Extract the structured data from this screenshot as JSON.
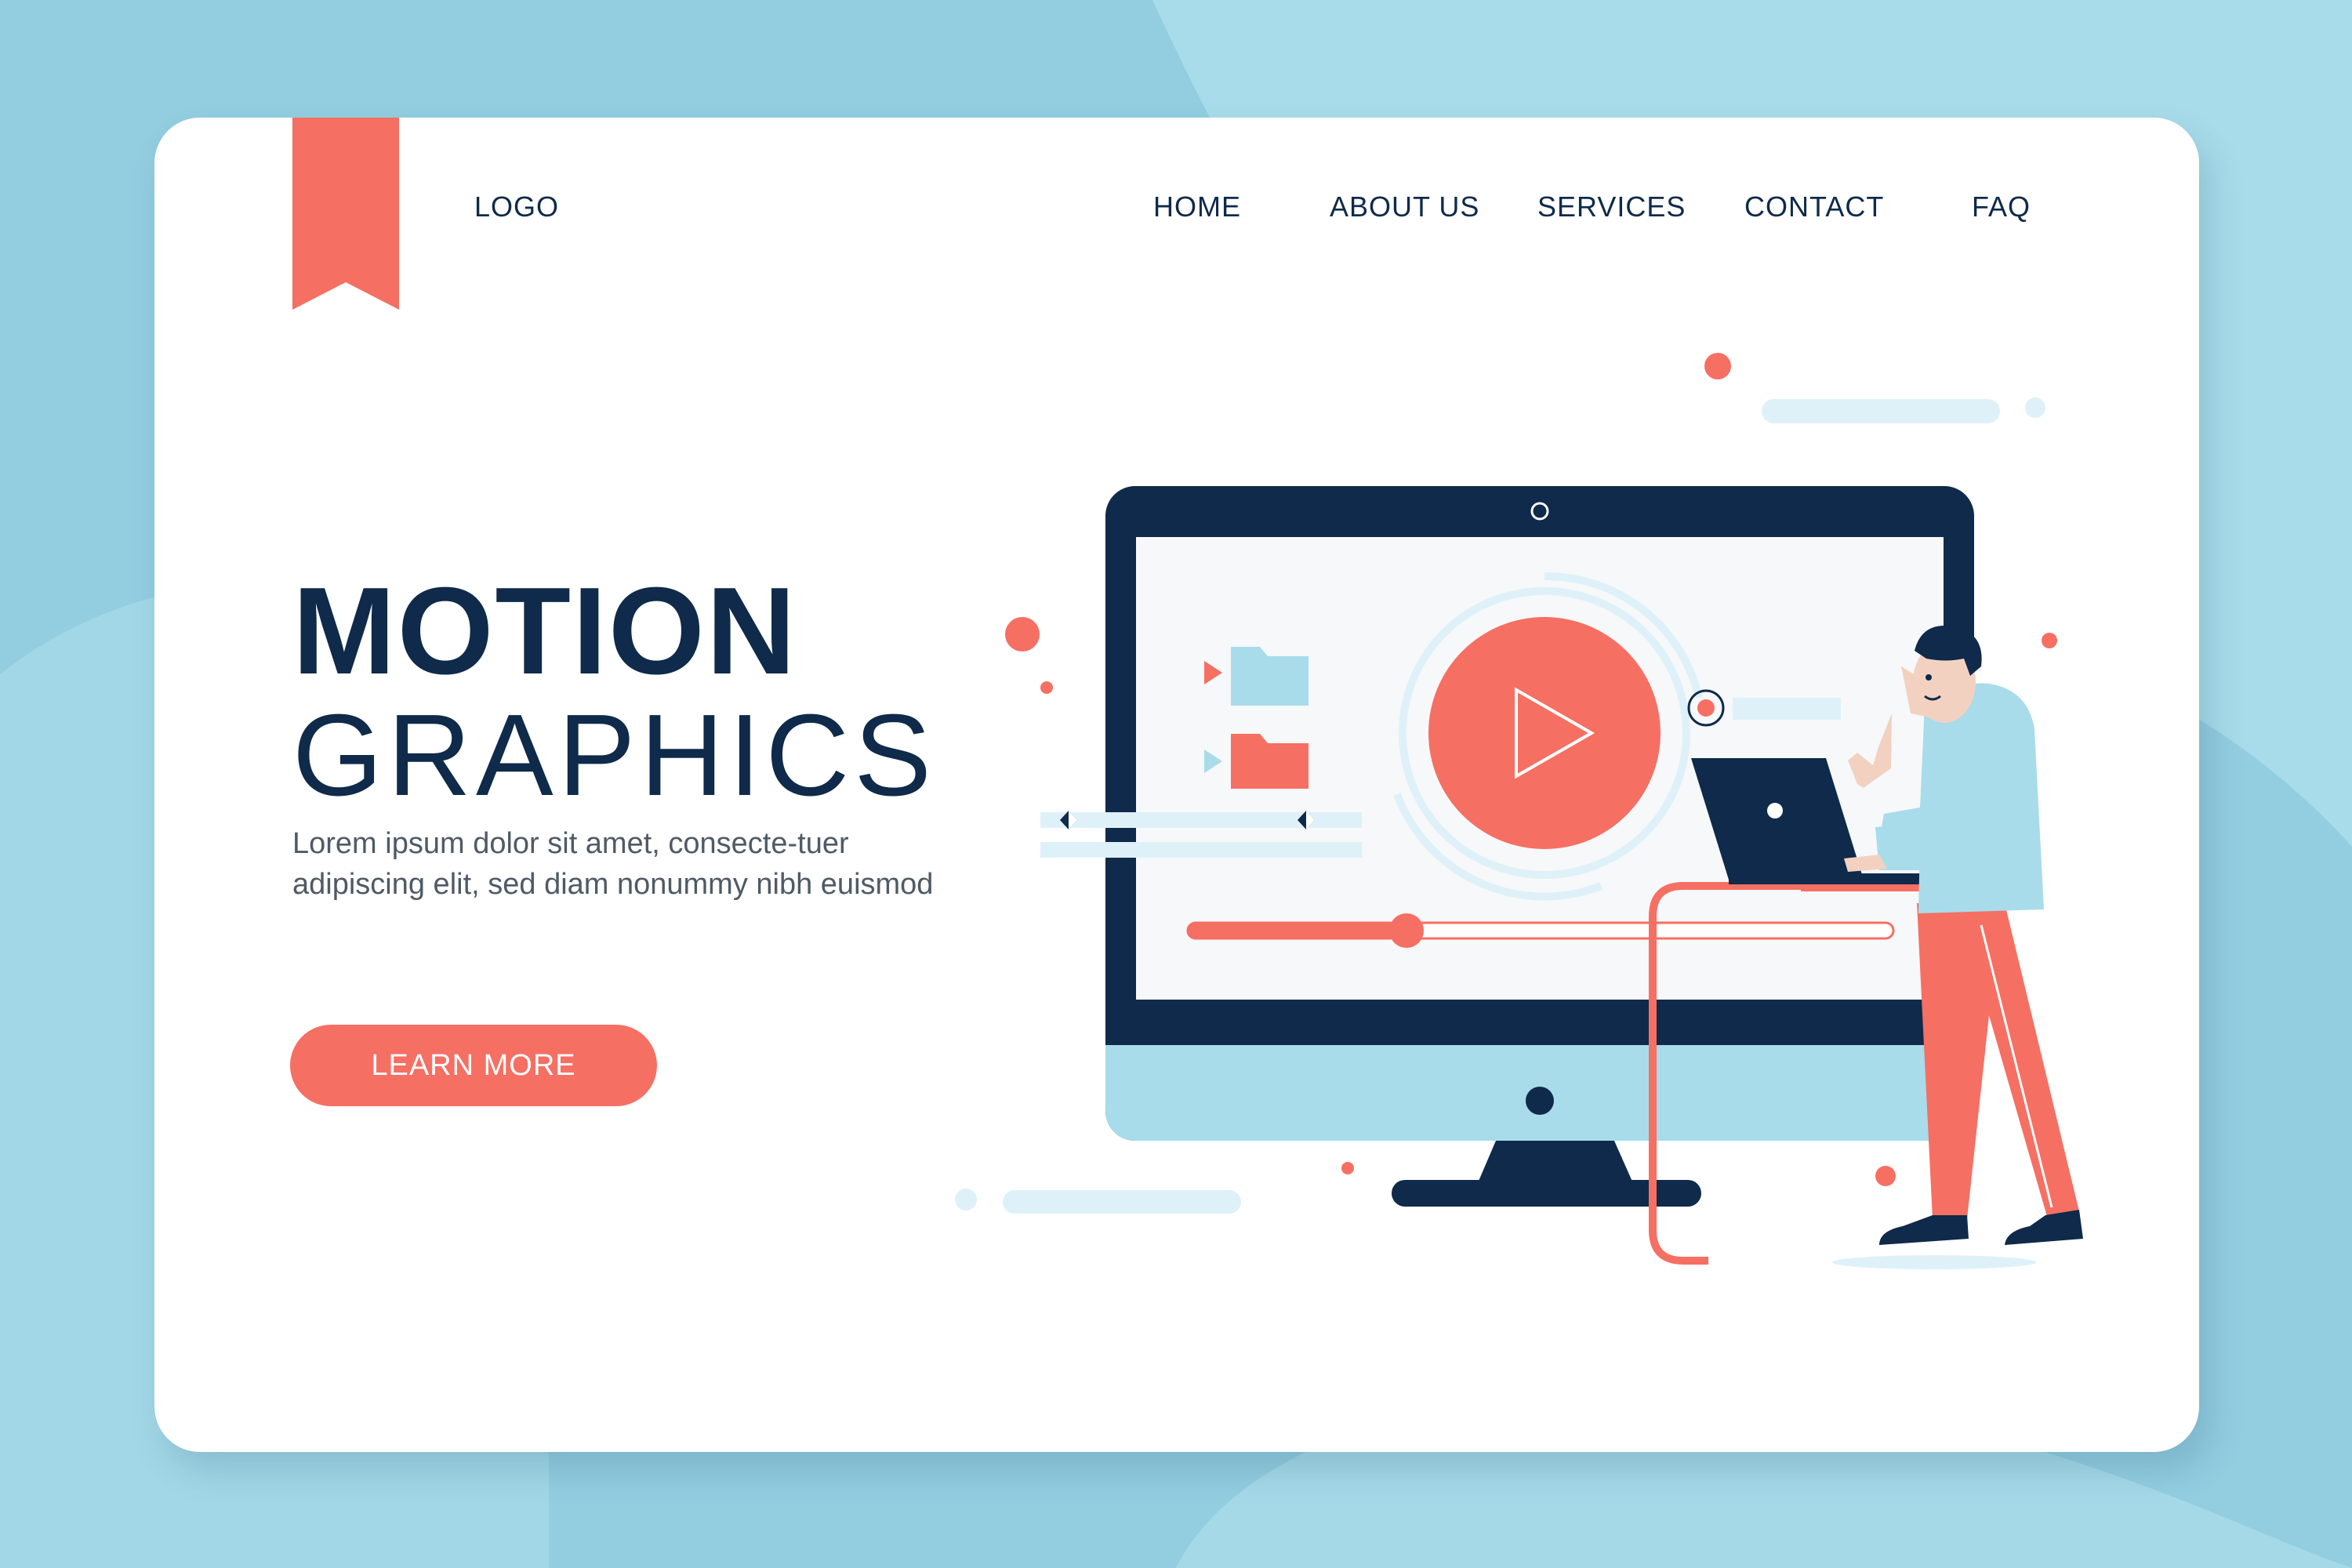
{
  "header": {
    "logo": "LOGO",
    "nav": [
      "HOME",
      "ABOUT US",
      "SERVICES",
      "CONTACT",
      "FAQ"
    ]
  },
  "hero": {
    "title_bold": "MOTION",
    "title_light": "GRAPHICS",
    "description": "Lorem ipsum dolor sit amet, consecte-tuer adipiscing elit, sed diam nonummy nibh euismod",
    "cta_label": "LEARN MORE"
  },
  "video_player": {
    "progress": 0.31
  },
  "icons": [
    "bookmark-ribbon-icon",
    "webcam-icon",
    "play-icon",
    "folder-icon",
    "caret-right-icon",
    "keyframe-icon",
    "record-icon",
    "laptop-icon"
  ],
  "colors": {
    "navy": "#0f2a4a",
    "coral": "#f66f63",
    "light_blue": "#a8dcea",
    "background": "#93cde0",
    "card": "#ffffff"
  }
}
